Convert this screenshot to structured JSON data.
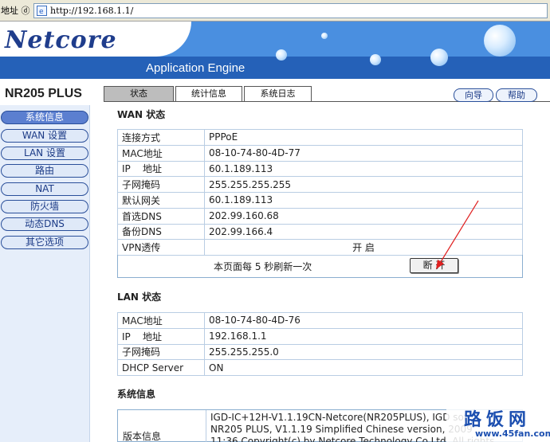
{
  "browser": {
    "address_label": "地址 ⓓ",
    "url": "http://192.168.1.1/"
  },
  "header": {
    "logo": "Netcore",
    "tagline": "Application Engine"
  },
  "sidebar": {
    "model": "NR205 PLUS",
    "items": [
      {
        "label": "系统信息",
        "active": true
      },
      {
        "label": "WAN 设置"
      },
      {
        "label": "LAN 设置"
      },
      {
        "label": "路由"
      },
      {
        "label": "NAT"
      },
      {
        "label": "防火墙"
      },
      {
        "label": "动态DNS"
      },
      {
        "label": "其它选项"
      }
    ]
  },
  "tabs": [
    {
      "label": "状态",
      "active": true
    },
    {
      "label": "统计信息"
    },
    {
      "label": "系统日志"
    }
  ],
  "top_buttons": {
    "wizard": "向导",
    "help": "帮助"
  },
  "wan": {
    "title": "WAN 状态",
    "rows": [
      {
        "key": "连接方式",
        "value": "PPPoE"
      },
      {
        "key": "MAC地址",
        "value": "08-10-74-80-4D-77"
      },
      {
        "key": "IP    地址",
        "value": "60.1.189.113"
      },
      {
        "key": "子网掩码",
        "value": "255.255.255.255"
      },
      {
        "key": "默认网关",
        "value": "60.1.189.113"
      },
      {
        "key": "首选DNS",
        "value": "202.99.160.68"
      },
      {
        "key": "备份DNS",
        "value": "202.99.166.4"
      },
      {
        "key": "VPN透传",
        "value": "开 启"
      }
    ],
    "refresh_text": "本页面每 5 秒刷新一次",
    "disconnect_label": "断 开"
  },
  "lan": {
    "title": "LAN 状态",
    "rows": [
      {
        "key": "MAC地址",
        "value": "08-10-74-80-4D-76"
      },
      {
        "key": "IP    地址",
        "value": "192.168.1.1"
      },
      {
        "key": "子网掩码",
        "value": "255.255.255.0"
      },
      {
        "key": "DHCP Server",
        "value": "ON"
      }
    ]
  },
  "system": {
    "title": "系统信息",
    "version_key": "版本信息",
    "version_value": "IGD-IC+12H-V1.1.19CN-Netcore(NR205PLUS), IGD soft\nNR205 PLUS, V1.1.19 Simplified Chinese version, 2009\n11:36 Copyright(c) by Netcore Technology Co.Ltd. All rights"
  },
  "watermark": {
    "main": "路饭网",
    "sub": "www.45fan.com"
  },
  "colors": {
    "banner": "#2f6fc4",
    "nav_border": "#2a4f9a",
    "table_border": "#8aaed0",
    "arrow": "#e02020"
  }
}
